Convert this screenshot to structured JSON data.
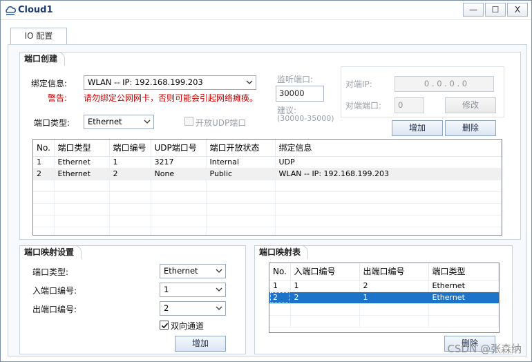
{
  "window": {
    "title": "Cloud1",
    "min_glyph": "—",
    "max_glyph": "☐",
    "close_glyph": "X"
  },
  "tab": {
    "label": "IO 配置"
  },
  "port_create": {
    "title": "端口创建",
    "bind_label": "绑定信息:",
    "bind_value": "WLAN -- IP: 192.168.199.203",
    "warning_label": "警告:",
    "warning_text": "请勿绑定公网网卡，否则可能会引起网络瘫痪。",
    "port_type_label": "端口类型:",
    "port_type_value": "Ethernet",
    "udp_label": "开放UDP端口",
    "listen_label": "监听端口:",
    "listen_value": "30000",
    "suggest_label": "建议:",
    "suggest_range": "(30000-35000)",
    "peer_ip_label": "对端IP:",
    "peer_ip_value": "0  .  0  .  0  .  0",
    "peer_port_label": "对端端口:",
    "peer_port_value": "0",
    "modify_button": "修改",
    "add_button": "增加",
    "delete_button": "删除",
    "table": {
      "headers": [
        "No.",
        "端口类型",
        "端口编号",
        "UDP端口号",
        "端口开放状态",
        "绑定信息"
      ],
      "rows": [
        [
          "1",
          "Ethernet",
          "1",
          "3217",
          "Internal",
          "UDP"
        ],
        [
          "2",
          "Ethernet",
          "2",
          "None",
          "Public",
          "WLAN -- IP: 192.168.199.203"
        ]
      ]
    }
  },
  "port_map_setting": {
    "title": "端口映射设置",
    "port_type_label": "端口类型:",
    "port_type_value": "Ethernet",
    "in_port_label": "入端口编号:",
    "in_port_value": "1",
    "out_port_label": "出端口编号:",
    "out_port_value": "2",
    "bidirectional_label": "双向通道",
    "add_button": "增加"
  },
  "port_map_table": {
    "title": "端口映射表",
    "headers": [
      "No.",
      "入端口编号",
      "出端口编号",
      "端口类型"
    ],
    "rows": [
      [
        "1",
        "1",
        "2",
        "Ethernet"
      ],
      [
        "2",
        "2",
        "1",
        "Ethernet"
      ]
    ],
    "delete_button": "删除"
  },
  "watermark": "CSDN @张森纳"
}
